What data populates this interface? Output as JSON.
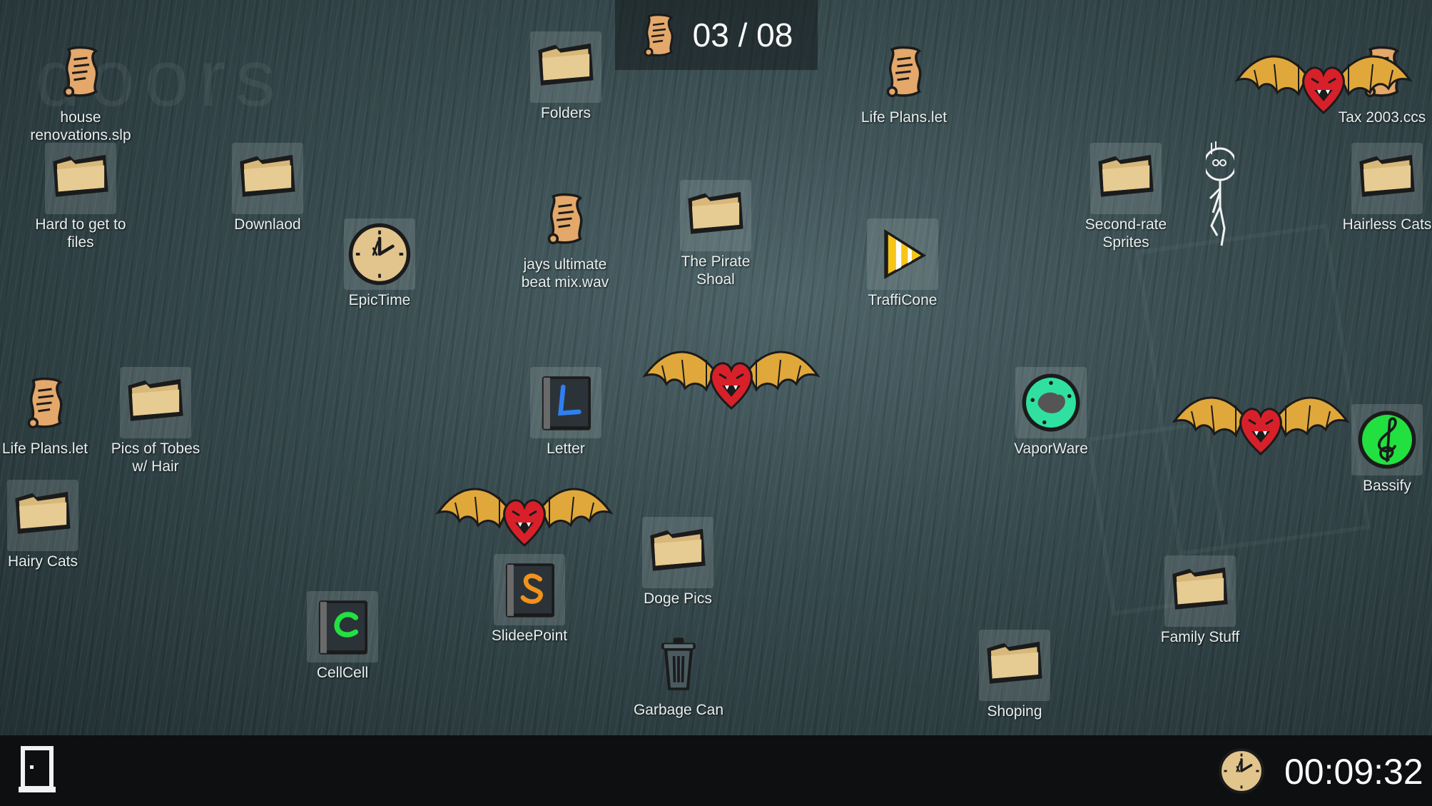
{
  "hud": {
    "counter": "03 / 08",
    "timer": "00:09:32"
  },
  "background": {
    "logo_text": "doors"
  },
  "icons": [
    {
      "name": "file-house-renovations",
      "type": "scroll",
      "label": "house renovations.slp"
    },
    {
      "name": "folder-folders",
      "type": "folder",
      "label": "Folders"
    },
    {
      "name": "file-life-plans-top",
      "type": "scroll",
      "label": "Life Plans.let"
    },
    {
      "name": "file-tax-2003",
      "type": "scroll",
      "label": "Tax 2003.ccs"
    },
    {
      "name": "folder-hard-to-get-to-files",
      "type": "folder",
      "label": "Hard to get to files"
    },
    {
      "name": "folder-downlaod",
      "type": "folder",
      "label": "Downlaod"
    },
    {
      "name": "app-epictime",
      "type": "clock",
      "label": "EpicTime"
    },
    {
      "name": "file-jays-ultimate-beat-mix",
      "type": "scroll",
      "label": "jays ultimate beat mix.wav"
    },
    {
      "name": "folder-the-pirate-shoal",
      "type": "folder",
      "label": "The Pirate Shoal"
    },
    {
      "name": "app-trafficone",
      "type": "cone",
      "label": "TraffiCone"
    },
    {
      "name": "folder-second-rate-sprites",
      "type": "folder",
      "label": "Second-rate Sprites"
    },
    {
      "name": "folder-hairless-cats",
      "type": "folder",
      "label": "Hairless Cats"
    },
    {
      "name": "file-life-plans-left",
      "type": "scroll",
      "label": "Life Plans.let"
    },
    {
      "name": "folder-pics-of-tobes",
      "type": "folder",
      "label": "Pics of Tobes w/ Hair"
    },
    {
      "name": "app-letter",
      "type": "book-letter",
      "label": "Letter"
    },
    {
      "name": "app-vaporware",
      "type": "vapor",
      "label": "VaporWare"
    },
    {
      "name": "app-bassify",
      "type": "bass",
      "label": "Bassify"
    },
    {
      "name": "folder-hairy-cats",
      "type": "folder",
      "label": "Hairy Cats"
    },
    {
      "name": "app-slideepoint",
      "type": "book-slide",
      "label": "SlideePoint"
    },
    {
      "name": "folder-doge-pics",
      "type": "folder",
      "label": "Doge Pics"
    },
    {
      "name": "folder-family-stuff",
      "type": "folder",
      "label": "Family Stuff"
    },
    {
      "name": "app-cellcell",
      "type": "book-cell",
      "label": "CellCell"
    },
    {
      "name": "app-garbage-can",
      "type": "trash",
      "label": "Garbage Can"
    },
    {
      "name": "folder-shoping",
      "type": "folder",
      "label": "Shoping"
    }
  ],
  "enemies": [
    "heart-bat",
    "heart-bat",
    "heart-bat",
    "heart-bat"
  ],
  "colors": {
    "folder": "#d8b87a",
    "scroll": "#e3a86a",
    "bat_wing": "#e0a83a",
    "heart": "#d8202a",
    "bassify": "#22e040",
    "vapor": "#30e0a0",
    "cone": "#f5c518"
  }
}
